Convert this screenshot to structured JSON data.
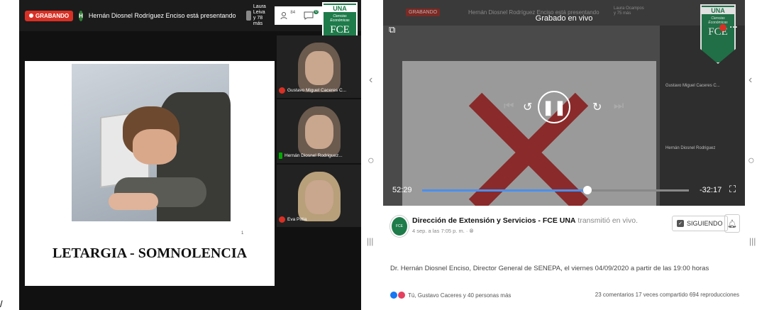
{
  "left_panel": {
    "recording_label": "GRABANDO",
    "presenter_initial": "H",
    "presenter_text": "Hernán Diosnel Rodríguez Enciso está presentando",
    "viewers_line1": "Laura Leiva",
    "viewers_line2": "y 78 más",
    "participants_count": "84",
    "chat_count": "0",
    "badge": {
      "top": "UNA",
      "middle": "Ciencias Económicas",
      "bottom": "FCE"
    },
    "slide_title": "LETARGIA - SOMNOLENCIA",
    "slide_number": "1",
    "participants": [
      {
        "name": "Gustavo Miguel Caceres C..."
      },
      {
        "name": "Hernán Diosnel Rodriguez..."
      },
      {
        "name": "Eva Pittia"
      }
    ],
    "corner_char": "/"
  },
  "side_nav": {
    "chevron_left": "‹",
    "home": "○",
    "menu": "|||"
  },
  "video": {
    "title": "Grabado en vivo",
    "elapsed": "52:29",
    "remaining": "-32:17",
    "progress_fraction": 0.62,
    "faded_recording_label": "GRABANDO",
    "faded_presenter_text": "Hernán Diosnel Rodríguez Enciso está presentando",
    "faded_viewers_line1": "Laura Ocampos",
    "faded_viewers_line2": "y 75 más",
    "faded_participants": [
      {
        "name": "Gustavo Miguel Caceres C..."
      },
      {
        "name": "Hernán Diosnel Rodriguez"
      }
    ]
  },
  "post": {
    "page_name": "Dirección de Extensión y Servicios - FCE UNA",
    "action": "transmitió en vivo.",
    "meta": "4 sep. a las 7:05 p. m. · ",
    "follow_label": "SIGUIENDO",
    "description": "Dr. Hernán Diosnel Enciso, Director General de SENEPA, el viernes 04/09/2020 a partir de las 19:00 horas",
    "reactions_text": "Tú, Gustavo Caceres y 40 personas más",
    "stats": "23 comentarios 17 veces compartido 694 reproducciones"
  },
  "colors": {
    "rec": "#d93025",
    "una_green": "#1e7b4a",
    "progress": "#4a8ff0"
  }
}
